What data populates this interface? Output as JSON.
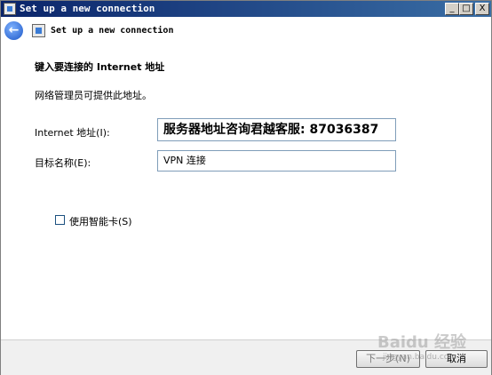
{
  "window": {
    "title": "Set up a new connection",
    "controls": {
      "minimize": "_",
      "maximize": "□",
      "close": "X"
    }
  },
  "nav": {
    "title": "Set up a new connection",
    "back_icon": "back-arrow-icon"
  },
  "content": {
    "heading": "键入要连接的 Internet 地址",
    "subtext": "网络管理员可提供此地址。",
    "address_label": "Internet 地址(I):",
    "address_value": "服务器地址咨询君越客服: 87036387",
    "dest_label": "目标名称(E):",
    "dest_value": "VPN 连接",
    "smartcard_label": "使用智能卡(S)",
    "smartcard_checked": false
  },
  "footer": {
    "next_label": "下一步(N)",
    "cancel_label": "取消"
  },
  "watermark": {
    "text": "Baidu 经验",
    "url": "jingyan.baidu.com"
  }
}
